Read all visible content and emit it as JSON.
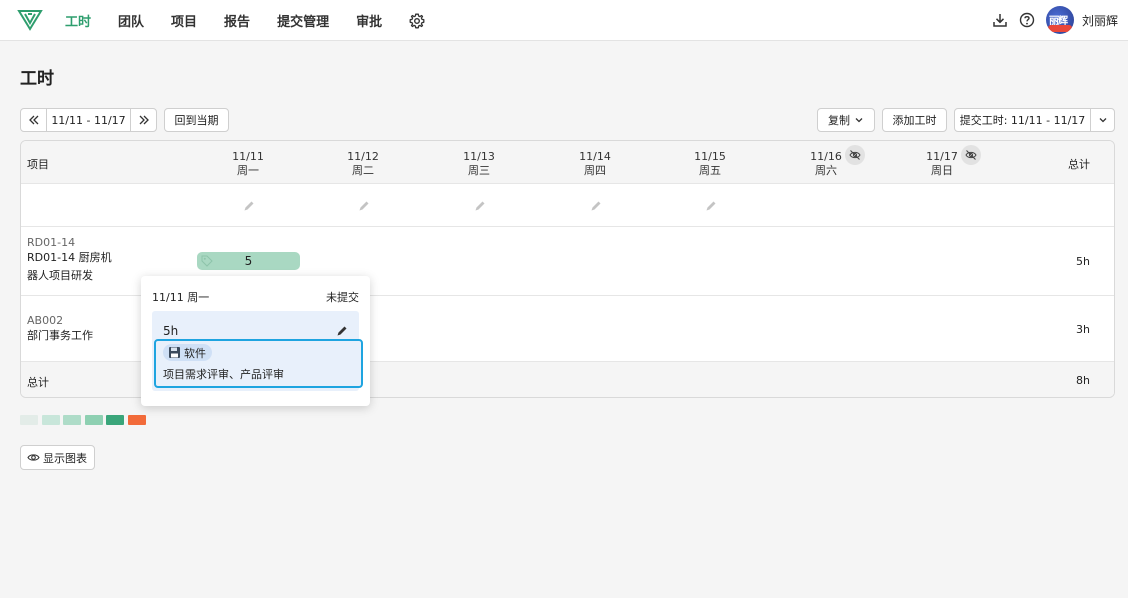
{
  "nav": {
    "items": [
      "工时",
      "团队",
      "项目",
      "报告",
      "提交管理",
      "审批"
    ],
    "active_index": 0
  },
  "user": {
    "name": "刘丽辉",
    "avatar_text": "丽辉"
  },
  "page": {
    "title": "工时"
  },
  "toolbar": {
    "range": "11/11 - 11/17",
    "current_period": "回到当期",
    "copy": "复制",
    "add_hours": "添加工时",
    "submit": "提交工时: 11/11 - 11/17"
  },
  "table": {
    "project_header": "项目",
    "total_header": "总计",
    "days": [
      {
        "date": "11/11",
        "weekday": "周一",
        "hidden": false
      },
      {
        "date": "11/12",
        "weekday": "周二",
        "hidden": false
      },
      {
        "date": "11/13",
        "weekday": "周三",
        "hidden": false
      },
      {
        "date": "11/14",
        "weekday": "周四",
        "hidden": false
      },
      {
        "date": "11/15",
        "weekday": "周五",
        "hidden": false
      },
      {
        "date": "11/16",
        "weekday": "周六",
        "hidden": true
      },
      {
        "date": "11/17",
        "weekday": "周日",
        "hidden": true
      }
    ],
    "projects": [
      {
        "code": "RD01-14",
        "name_line1": "RD01-14 厨房机",
        "name_line2": "器人项目研发",
        "hours_mon": "5",
        "total": "5h"
      },
      {
        "code": "AB002",
        "name_line1": "部门事务工作",
        "total": "3h"
      }
    ],
    "total_label": "总计",
    "grand_total": "8h"
  },
  "legend_colors": [
    "#e3ece8",
    "#c8e6da",
    "#aedcc8",
    "#8ed0b2",
    "#3aa57a",
    "#f26b3a"
  ],
  "show_chart": "显示图表",
  "popover": {
    "date": "11/11 周一",
    "status": "未提交",
    "hours": "5h",
    "entry": {
      "tag": "软件",
      "description": "项目需求评审、产品评审"
    }
  }
}
